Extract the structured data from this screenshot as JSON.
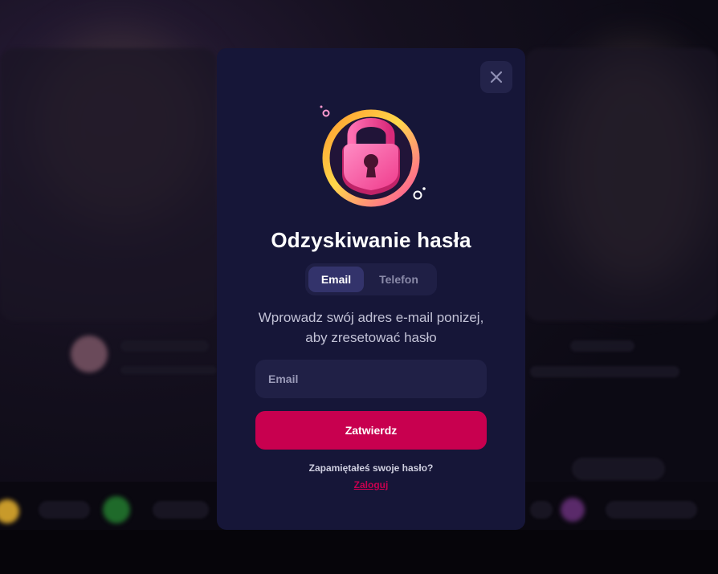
{
  "modal": {
    "title": "Odzyskiwanie hasła",
    "tabs": [
      {
        "label": "Email",
        "active": true
      },
      {
        "label": "Telefon",
        "active": false
      }
    ],
    "description_line1": "Wprowadz swój adres e-mail ponizej,",
    "description_line2": "aby zresetować hasło",
    "email_input": {
      "placeholder": "Email",
      "value": ""
    },
    "submit_label": "Zatwierdz",
    "remember_text": "Zapamiętałeś swoje hasło?",
    "login_link": "Zaloguj",
    "illustration_icon": "padlock-icon",
    "close_icon": "close-icon"
  },
  "colors": {
    "modal_bg": "#161638",
    "accent": "#c8004f",
    "tab_active": "#33336b",
    "input_bg": "#202046"
  }
}
